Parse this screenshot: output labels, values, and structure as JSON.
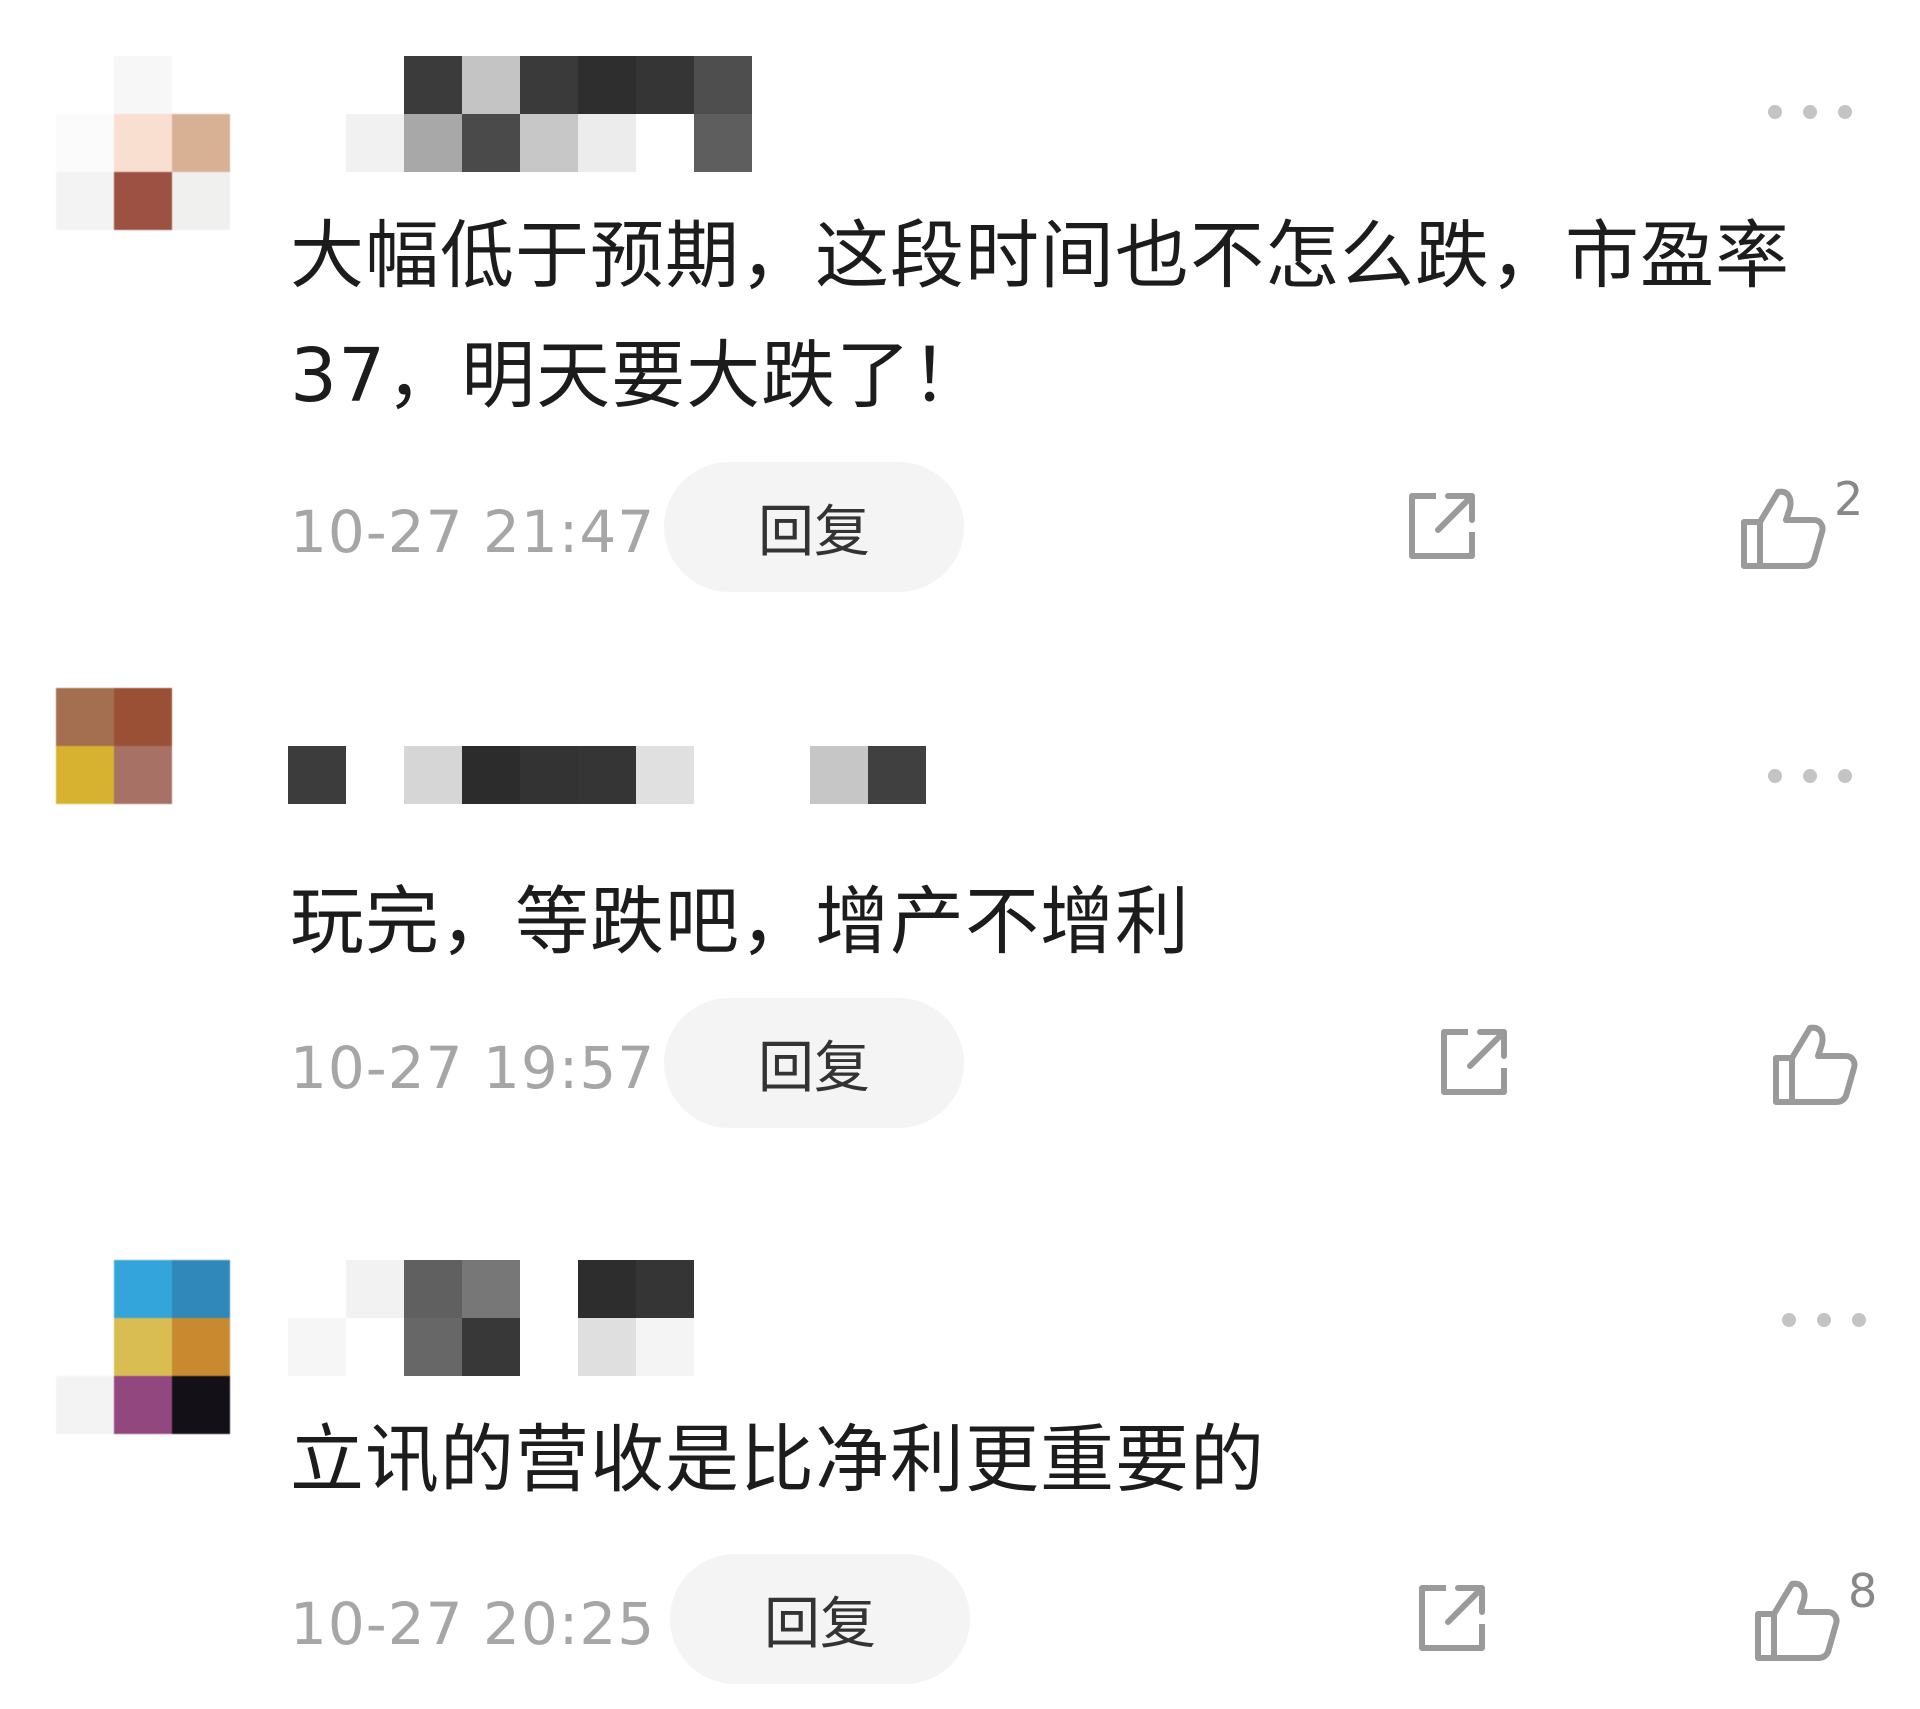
{
  "comments": [
    {
      "text": "大幅低于预期，这段时间也不怎么跌，市盈率37，明天要大跌了！",
      "time": "10-27 21:47",
      "reply_label": "回复",
      "likes": "2"
    },
    {
      "text": "玩完，等跌吧，增产不增利",
      "time": "10-27 19:57",
      "reply_label": "回复",
      "likes": ""
    },
    {
      "text": "立讯的营收是比净利更重要的",
      "time": "10-27 20:25",
      "reply_label": "回复",
      "likes": "8"
    }
  ],
  "icons": {
    "more": "more-dots-icon",
    "share": "share-icon",
    "like": "thumbs-up-icon"
  },
  "colors": {
    "text": "#1c1c1c",
    "meta": "#a6a6a6",
    "icon": "#9a9a9a",
    "reply_bg": "#f4f4f4"
  }
}
